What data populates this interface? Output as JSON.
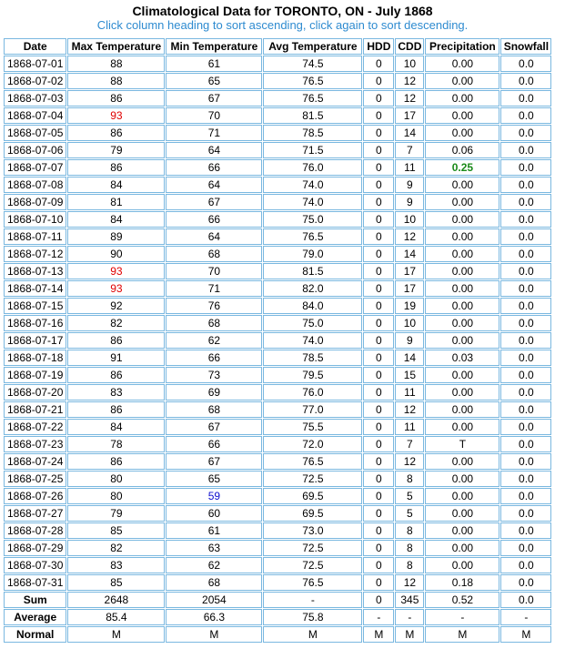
{
  "title": "Climatological Data for TORONTO, ON - July 1868",
  "subtitle": "Click column heading to sort ascending, click again to sort descending.",
  "columns": [
    "Date",
    "Max Temperature",
    "Min Temperature",
    "Avg Temperature",
    "HDD",
    "CDD",
    "Precipitation",
    "Snowfall"
  ],
  "rows": [
    [
      "1868-07-01",
      "88",
      "61",
      "74.5",
      "0",
      "10",
      "0.00",
      "0.0"
    ],
    [
      "1868-07-02",
      "88",
      "65",
      "76.5",
      "0",
      "12",
      "0.00",
      "0.0"
    ],
    [
      "1868-07-03",
      "86",
      "67",
      "76.5",
      "0",
      "12",
      "0.00",
      "0.0"
    ],
    [
      "1868-07-04",
      "93",
      "70",
      "81.5",
      "0",
      "17",
      "0.00",
      "0.0"
    ],
    [
      "1868-07-05",
      "86",
      "71",
      "78.5",
      "0",
      "14",
      "0.00",
      "0.0"
    ],
    [
      "1868-07-06",
      "79",
      "64",
      "71.5",
      "0",
      "7",
      "0.06",
      "0.0"
    ],
    [
      "1868-07-07",
      "86",
      "66",
      "76.0",
      "0",
      "11",
      "0.25",
      "0.0"
    ],
    [
      "1868-07-08",
      "84",
      "64",
      "74.0",
      "0",
      "9",
      "0.00",
      "0.0"
    ],
    [
      "1868-07-09",
      "81",
      "67",
      "74.0",
      "0",
      "9",
      "0.00",
      "0.0"
    ],
    [
      "1868-07-10",
      "84",
      "66",
      "75.0",
      "0",
      "10",
      "0.00",
      "0.0"
    ],
    [
      "1868-07-11",
      "89",
      "64",
      "76.5",
      "0",
      "12",
      "0.00",
      "0.0"
    ],
    [
      "1868-07-12",
      "90",
      "68",
      "79.0",
      "0",
      "14",
      "0.00",
      "0.0"
    ],
    [
      "1868-07-13",
      "93",
      "70",
      "81.5",
      "0",
      "17",
      "0.00",
      "0.0"
    ],
    [
      "1868-07-14",
      "93",
      "71",
      "82.0",
      "0",
      "17",
      "0.00",
      "0.0"
    ],
    [
      "1868-07-15",
      "92",
      "76",
      "84.0",
      "0",
      "19",
      "0.00",
      "0.0"
    ],
    [
      "1868-07-16",
      "82",
      "68",
      "75.0",
      "0",
      "10",
      "0.00",
      "0.0"
    ],
    [
      "1868-07-17",
      "86",
      "62",
      "74.0",
      "0",
      "9",
      "0.00",
      "0.0"
    ],
    [
      "1868-07-18",
      "91",
      "66",
      "78.5",
      "0",
      "14",
      "0.03",
      "0.0"
    ],
    [
      "1868-07-19",
      "86",
      "73",
      "79.5",
      "0",
      "15",
      "0.00",
      "0.0"
    ],
    [
      "1868-07-20",
      "83",
      "69",
      "76.0",
      "0",
      "11",
      "0.00",
      "0.0"
    ],
    [
      "1868-07-21",
      "86",
      "68",
      "77.0",
      "0",
      "12",
      "0.00",
      "0.0"
    ],
    [
      "1868-07-22",
      "84",
      "67",
      "75.5",
      "0",
      "11",
      "0.00",
      "0.0"
    ],
    [
      "1868-07-23",
      "78",
      "66",
      "72.0",
      "0",
      "7",
      "T",
      "0.0"
    ],
    [
      "1868-07-24",
      "86",
      "67",
      "76.5",
      "0",
      "12",
      "0.00",
      "0.0"
    ],
    [
      "1868-07-25",
      "80",
      "65",
      "72.5",
      "0",
      "8",
      "0.00",
      "0.0"
    ],
    [
      "1868-07-26",
      "80",
      "59",
      "69.5",
      "0",
      "5",
      "0.00",
      "0.0"
    ],
    [
      "1868-07-27",
      "79",
      "60",
      "69.5",
      "0",
      "5",
      "0.00",
      "0.0"
    ],
    [
      "1868-07-28",
      "85",
      "61",
      "73.0",
      "0",
      "8",
      "0.00",
      "0.0"
    ],
    [
      "1868-07-29",
      "82",
      "63",
      "72.5",
      "0",
      "8",
      "0.00",
      "0.0"
    ],
    [
      "1868-07-30",
      "83",
      "62",
      "72.5",
      "0",
      "8",
      "0.00",
      "0.0"
    ],
    [
      "1868-07-31",
      "85",
      "68",
      "76.5",
      "0",
      "12",
      "0.18",
      "0.0"
    ]
  ],
  "highlights": {
    "max_high_color": "#e00000",
    "min_low_color": "#1010d0",
    "precip_max_color": "#1a8a1a",
    "max_high_value": "93",
    "min_low_value": "59",
    "precip_max_value": "0.25"
  },
  "summary": [
    [
      "Sum",
      "2648",
      "2054",
      "-",
      "0",
      "345",
      "0.52",
      "0.0"
    ],
    [
      "Average",
      "85.4",
      "66.3",
      "75.8",
      "-",
      "-",
      "-",
      "-"
    ],
    [
      "Normal",
      "M",
      "M",
      "M",
      "M",
      "M",
      "M",
      "M"
    ]
  ]
}
